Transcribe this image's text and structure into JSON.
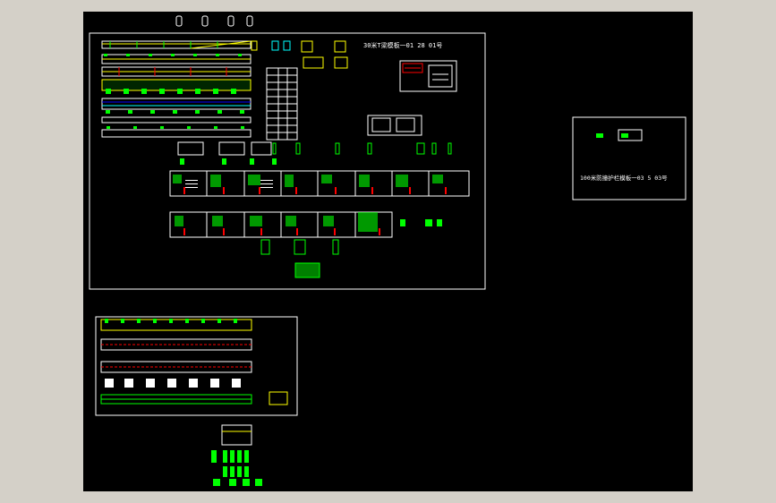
{
  "drawing": {
    "sheet_title_main": "30米T梁模板一01 28 01号",
    "sheet_title_side": "100米防撞护栏模板一03 5 03号"
  },
  "colors": {
    "background": "#000000",
    "frame": "#ffffff",
    "primary": "#00ff00",
    "highlight": "#ffff00",
    "accent": "#ff0000",
    "secondary": "#00ffff",
    "tertiary": "#0000ff"
  }
}
